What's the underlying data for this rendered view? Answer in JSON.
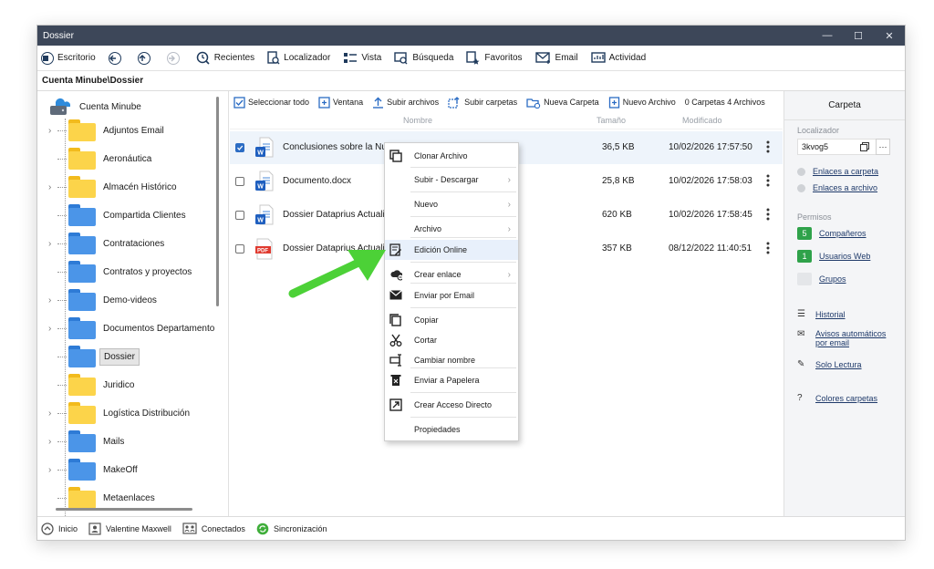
{
  "window": {
    "title": "Dossier",
    "minimize": "—",
    "maximize": "☐",
    "close": "✕"
  },
  "toolbar": {
    "items": [
      {
        "label": "Escritorio"
      },
      {
        "label": ""
      },
      {
        "label": ""
      },
      {
        "label": ""
      },
      {
        "label": "Recientes"
      },
      {
        "label": "Localizador"
      },
      {
        "label": "Vista"
      },
      {
        "label": "Búsqueda"
      },
      {
        "label": "Favoritos"
      },
      {
        "label": "Email"
      },
      {
        "label": "Actividad"
      }
    ]
  },
  "path": "Cuenta Minube\\Dossier",
  "tree": {
    "root": "Cuenta Minube",
    "items": [
      {
        "label": "Adjuntos Email",
        "color": "yellow",
        "expandable": true
      },
      {
        "label": "Aeronáutica",
        "color": "yellow",
        "expandable": false
      },
      {
        "label": "Almacén Histórico",
        "color": "yellow",
        "expandable": true
      },
      {
        "label": "Compartida Clientes",
        "color": "blue",
        "expandable": false
      },
      {
        "label": "Contrataciones",
        "color": "blue",
        "expandable": true
      },
      {
        "label": "Contratos y proyectos",
        "color": "blue",
        "expandable": false
      },
      {
        "label": "Demo-videos",
        "color": "blue",
        "expandable": true
      },
      {
        "label": "Documentos Departamento",
        "color": "blue",
        "expandable": true
      },
      {
        "label": "Dossier",
        "color": "blue",
        "expandable": false,
        "selected": true
      },
      {
        "label": "Juridico",
        "color": "yellow",
        "expandable": false
      },
      {
        "label": "Logística Distribución",
        "color": "yellow",
        "expandable": true
      },
      {
        "label": "Mails",
        "color": "blue",
        "expandable": true
      },
      {
        "label": "MakeOff",
        "color": "blue",
        "expandable": true
      },
      {
        "label": "Metaenlaces",
        "color": "yellow",
        "expandable": false
      }
    ]
  },
  "actions": {
    "select_all": "Seleccionar todo",
    "window": "Ventana",
    "upload_files": "Subir archivos",
    "upload_folders": "Subir carpetas",
    "new_folder": "Nueva Carpeta",
    "new_file": "Nuevo Archivo",
    "counts": "0 Carpetas  4 Archivos"
  },
  "columns": {
    "name": "Nombre",
    "size": "Tamaño",
    "modified": "Modificado"
  },
  "files": [
    {
      "name": "Conclusiones sobre la Nu",
      "type": "word",
      "size": "36,5 KB",
      "modified": "10/02/2026 17:57:50",
      "selected": true
    },
    {
      "name": "Documento.docx",
      "type": "word",
      "size": "25,8 KB",
      "modified": "10/02/2026 17:58:03",
      "selected": false
    },
    {
      "name": "Dossier Dataprius Actualiz",
      "type": "word",
      "size": "620 KB",
      "modified": "10/02/2026 17:58:45",
      "selected": false
    },
    {
      "name": "Dossier Dataprius Actualiz",
      "type": "pdf",
      "size": "357 KB",
      "modified": "08/12/2022 11:40:51",
      "selected": false
    }
  ],
  "context_menu": {
    "items": [
      {
        "label": "Clonar Archivo",
        "icon": "clone-icon",
        "submenu": false
      },
      {
        "label": "Subir - Descargar",
        "icon": "none",
        "submenu": true
      },
      {
        "label": "Nuevo",
        "icon": "none",
        "submenu": true
      },
      {
        "label": "Archivo",
        "icon": "none",
        "submenu": true
      },
      {
        "label": "Edición Online",
        "icon": "edit-online-icon",
        "submenu": false,
        "highlighted": true
      },
      {
        "label": "Crear enlace",
        "icon": "cloud-link-icon",
        "submenu": true
      },
      {
        "label": "Enviar por Email",
        "icon": "mail-icon",
        "submenu": false
      },
      {
        "label": "Copiar",
        "icon": "copy-icon",
        "submenu": false
      },
      {
        "label": "Cortar",
        "icon": "scissors-icon",
        "submenu": false
      },
      {
        "label": "Cambiar nombre",
        "icon": "rename-icon",
        "submenu": false
      },
      {
        "label": "Enviar a Papelera",
        "icon": "trash-icon",
        "submenu": false
      },
      {
        "label": "Crear Acceso Directo",
        "icon": "shortcut-icon",
        "submenu": false
      },
      {
        "label": "Propiedades",
        "icon": "none",
        "submenu": false
      }
    ]
  },
  "sidebar": {
    "header": "Carpeta",
    "locator_label": "Localizador",
    "locator_value": "3kvog5",
    "locator_more": "···",
    "link_folder": "Enlaces a carpeta",
    "link_file": "Enlaces a archivo",
    "permissions_label": "Permisos",
    "colleagues_count": "5",
    "colleagues": "Compañeros",
    "web_users_count": "1",
    "web_users": "Usuarios Web",
    "groups": "Grupos",
    "history": "Historial",
    "auto_alerts": "Avisos automáticos",
    "auto_alerts_2": "por email",
    "read_only": "Solo Lectura",
    "folder_colors": "Colores carpetas"
  },
  "statusbar": {
    "home": "Inicio",
    "user": "Valentine Maxwell",
    "connected": "Conectados",
    "sync": "Sincronización"
  },
  "colors": {
    "titlebar": "#3d4759",
    "accent": "#2b6cc4",
    "badge_green": "#2fa24a",
    "arrow_green": "#4cd137"
  }
}
